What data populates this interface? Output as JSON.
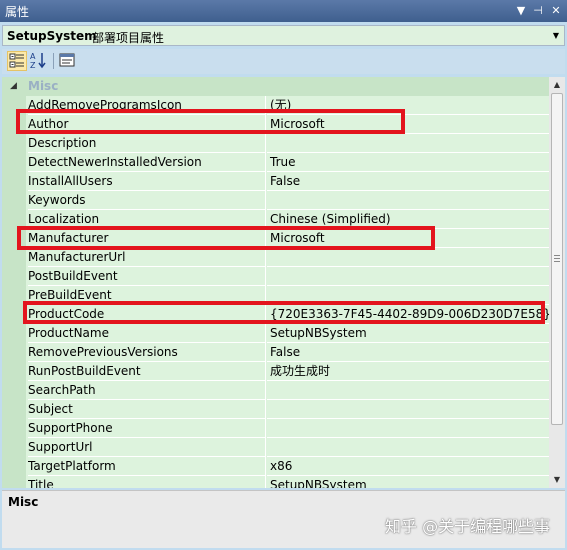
{
  "window": {
    "title": "属性",
    "buttons": [
      "▼",
      "⊣",
      "✕"
    ]
  },
  "selector": {
    "object_name": "SetupSystem",
    "object_type": "部署项目属性"
  },
  "category": {
    "label": "Misc",
    "toggle": "◢"
  },
  "properties": [
    {
      "name": "AddRemoveProgramsIcon",
      "value": "(无)"
    },
    {
      "name": "Author",
      "value": "Microsoft"
    },
    {
      "name": "Description",
      "value": ""
    },
    {
      "name": "DetectNewerInstalledVersion",
      "value": "True"
    },
    {
      "name": "InstallAllUsers",
      "value": "False"
    },
    {
      "name": "Keywords",
      "value": ""
    },
    {
      "name": "Localization",
      "value": "Chinese (Simplified)"
    },
    {
      "name": "Manufacturer",
      "value": "Microsoft"
    },
    {
      "name": "ManufacturerUrl",
      "value": ""
    },
    {
      "name": "PostBuildEvent",
      "value": ""
    },
    {
      "name": "PreBuildEvent",
      "value": ""
    },
    {
      "name": "ProductCode",
      "value": "{720E3363-7F45-4402-89D9-006D230D7E58}"
    },
    {
      "name": "ProductName",
      "value": "SetupNBSystem"
    },
    {
      "name": "RemovePreviousVersions",
      "value": "False"
    },
    {
      "name": "RunPostBuildEvent",
      "value": "成功生成时"
    },
    {
      "name": "SearchPath",
      "value": ""
    },
    {
      "name": "Subject",
      "value": ""
    },
    {
      "name": "SupportPhone",
      "value": ""
    },
    {
      "name": "SupportUrl",
      "value": ""
    },
    {
      "name": "TargetPlatform",
      "value": "x86"
    },
    {
      "name": "Title",
      "value": "SetupNBSystem"
    }
  ],
  "highlighted_properties": [
    "Author",
    "Manufacturer",
    "ProductCode"
  ],
  "description": {
    "title": "Misc"
  },
  "watermark": "知乎 @关于编程哪些事",
  "colors": {
    "highlight": "#e3141d",
    "row_background": "#ddf3dd",
    "title_bar": "#4a6a9b"
  }
}
